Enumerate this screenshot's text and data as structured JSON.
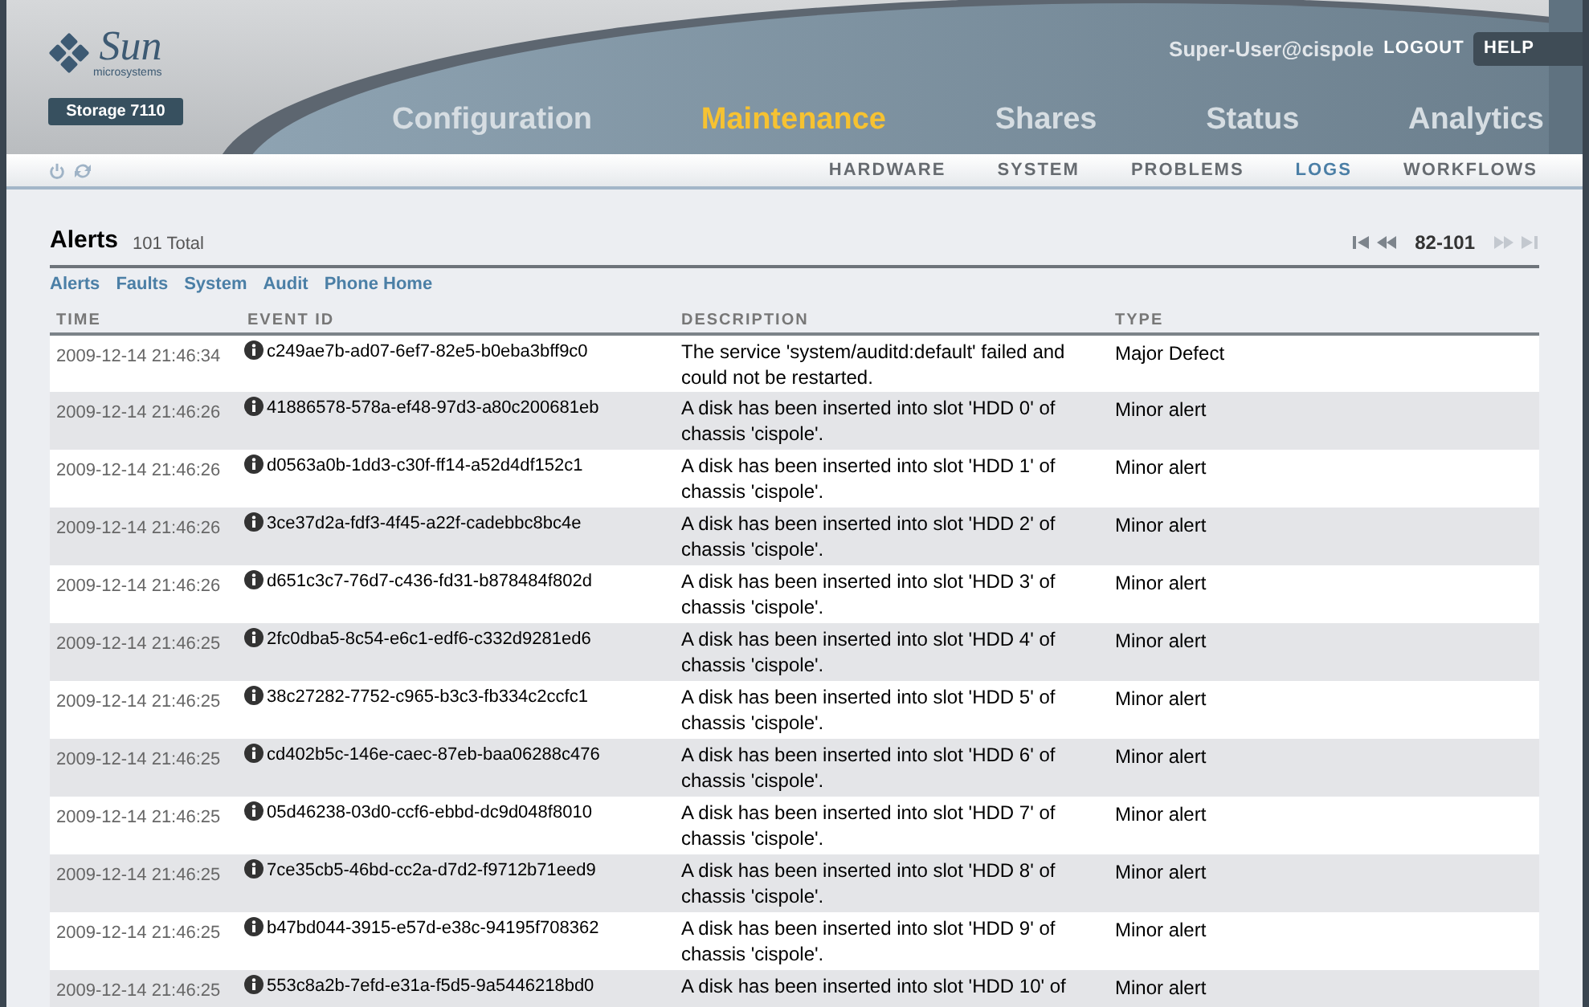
{
  "header": {
    "brand": "Sun",
    "brand_sub": "microsystems",
    "product": "Storage 7110",
    "user": "Super-User@cispole",
    "logout": "LOGOUT",
    "help": "HELP"
  },
  "tabs": [
    {
      "label": "Configuration",
      "selected": false
    },
    {
      "label": "Maintenance",
      "selected": true
    },
    {
      "label": "Shares",
      "selected": false
    },
    {
      "label": "Status",
      "selected": false
    },
    {
      "label": "Analytics",
      "selected": false
    }
  ],
  "subtabs": [
    {
      "label": "HARDWARE",
      "selected": false
    },
    {
      "label": "SYSTEM",
      "selected": false
    },
    {
      "label": "PROBLEMS",
      "selected": false
    },
    {
      "label": "LOGS",
      "selected": true
    },
    {
      "label": "WORKFLOWS",
      "selected": false
    }
  ],
  "section": {
    "title": "Alerts",
    "count": "101 Total"
  },
  "pager": {
    "range": "82-101",
    "at_start": false,
    "at_end": true
  },
  "log_links": [
    "Alerts",
    "Faults",
    "System",
    "Audit",
    "Phone Home"
  ],
  "table": {
    "columns": [
      "TIME",
      "EVENT ID",
      "DESCRIPTION",
      "TYPE"
    ],
    "rows": [
      {
        "time": "2009-12-14 21:46:34",
        "event_id": "c249ae7b-ad07-6ef7-82e5-b0eba3bff9c0",
        "description": "The service 'system/auditd:default' failed and could not be restarted.",
        "type": "Major Defect"
      },
      {
        "time": "2009-12-14 21:46:26",
        "event_id": "41886578-578a-ef48-97d3-a80c200681eb",
        "description": "A disk has been inserted into slot 'HDD 0' of chassis 'cispole'.",
        "type": "Minor alert"
      },
      {
        "time": "2009-12-14 21:46:26",
        "event_id": "d0563a0b-1dd3-c30f-ff14-a52d4df152c1",
        "description": "A disk has been inserted into slot 'HDD 1' of chassis 'cispole'.",
        "type": "Minor alert"
      },
      {
        "time": "2009-12-14 21:46:26",
        "event_id": "3ce37d2a-fdf3-4f45-a22f-cadebbc8bc4e",
        "description": "A disk has been inserted into slot 'HDD 2' of chassis 'cispole'.",
        "type": "Minor alert"
      },
      {
        "time": "2009-12-14 21:46:26",
        "event_id": "d651c3c7-76d7-c436-fd31-b878484f802d",
        "description": "A disk has been inserted into slot 'HDD 3' of chassis 'cispole'.",
        "type": "Minor alert"
      },
      {
        "time": "2009-12-14 21:46:25",
        "event_id": "2fc0dba5-8c54-e6c1-edf6-c332d9281ed6",
        "description": "A disk has been inserted into slot 'HDD 4' of chassis 'cispole'.",
        "type": "Minor alert"
      },
      {
        "time": "2009-12-14 21:46:25",
        "event_id": "38c27282-7752-c965-b3c3-fb334c2ccfc1",
        "description": "A disk has been inserted into slot 'HDD 5' of chassis 'cispole'.",
        "type": "Minor alert"
      },
      {
        "time": "2009-12-14 21:46:25",
        "event_id": "cd402b5c-146e-caec-87eb-baa06288c476",
        "description": "A disk has been inserted into slot 'HDD 6' of chassis 'cispole'.",
        "type": "Minor alert"
      },
      {
        "time": "2009-12-14 21:46:25",
        "event_id": "05d46238-03d0-ccf6-ebbd-dc9d048f8010",
        "description": "A disk has been inserted into slot 'HDD 7' of chassis 'cispole'.",
        "type": "Minor alert"
      },
      {
        "time": "2009-12-14 21:46:25",
        "event_id": "7ce35cb5-46bd-cc2a-d7d2-f9712b71eed9",
        "description": "A disk has been inserted into slot 'HDD 8' of chassis 'cispole'.",
        "type": "Minor alert"
      },
      {
        "time": "2009-12-14 21:46:25",
        "event_id": "b47bd044-3915-e57d-e38c-94195f708362",
        "description": "A disk has been inserted into slot 'HDD 9' of chassis 'cispole'.",
        "type": "Minor alert"
      },
      {
        "time": "2009-12-14 21:46:25",
        "event_id": "553c8a2b-7efd-e31a-f5d5-9a5446218bd0",
        "description": "A disk has been inserted into slot 'HDD 10' of",
        "type": "Minor alert"
      }
    ]
  }
}
